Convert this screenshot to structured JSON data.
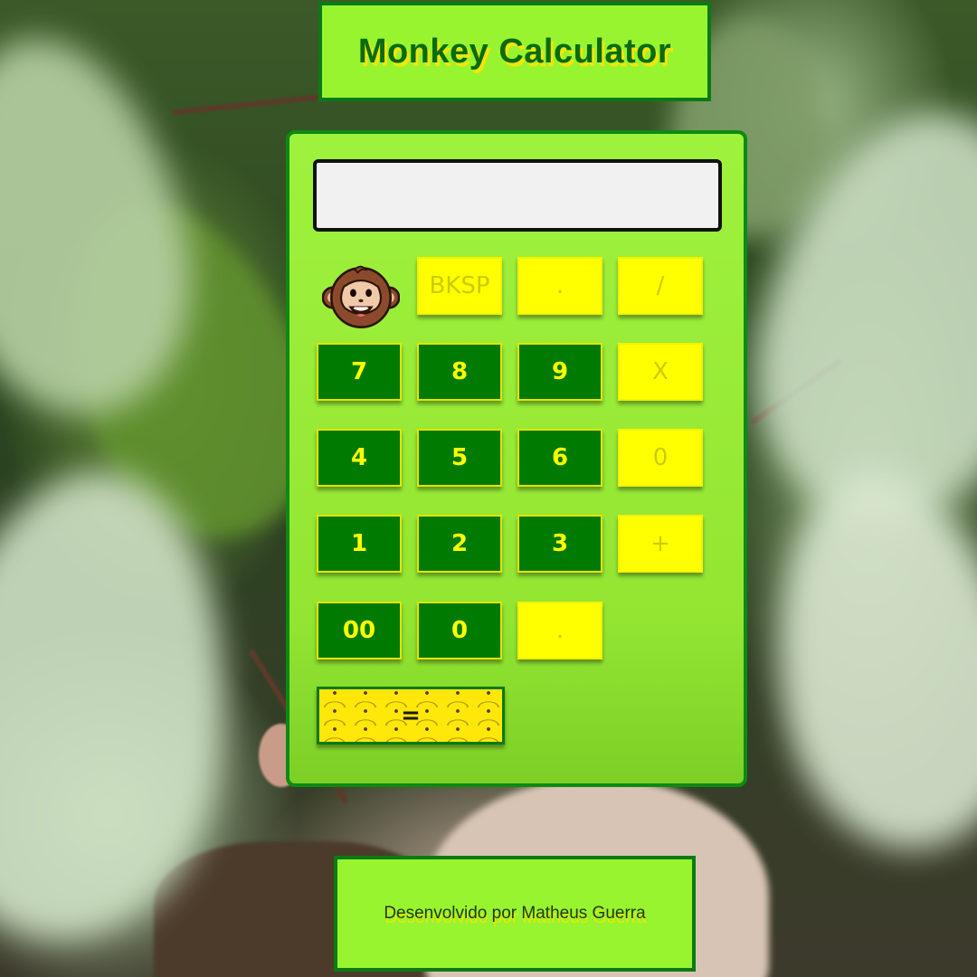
{
  "header": {
    "title": "Monkey Calculator"
  },
  "display": {
    "value": ""
  },
  "buttons": {
    "row1": [
      "BKSP",
      ".",
      "/"
    ],
    "row2": [
      "7",
      "8",
      "9",
      "X"
    ],
    "row3": [
      "4",
      "5",
      "6",
      "0"
    ],
    "row4": [
      "1",
      "2",
      "3",
      "+"
    ],
    "row5": [
      "00",
      "0",
      "."
    ],
    "equals": "="
  },
  "footer": {
    "credit": "Desenvolvido por Matheus Guerra"
  },
  "colors": {
    "panel": "#99f430",
    "border": "#0b7a13",
    "number_button": "#007a00",
    "operator_button": "#ffff00",
    "title_text": "#0b6b10",
    "title_shadow": "#f0e60a"
  },
  "icons": {
    "mascot": "monkey-face-icon"
  }
}
